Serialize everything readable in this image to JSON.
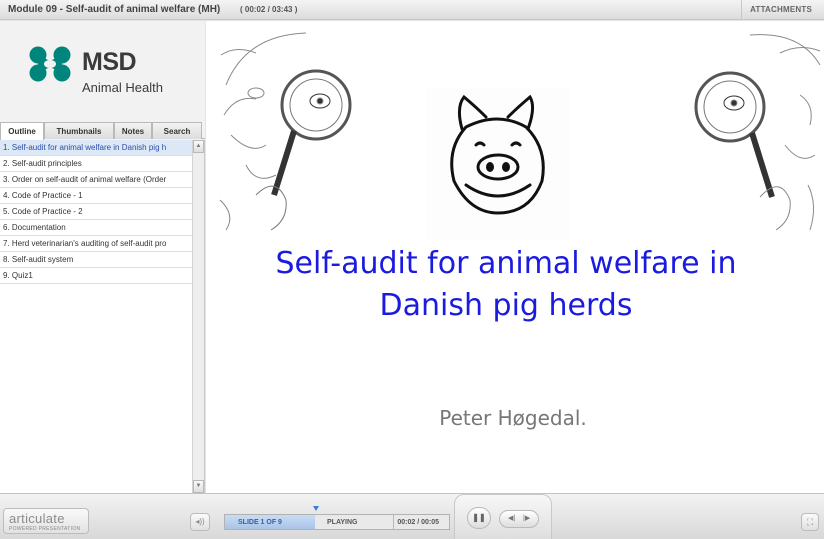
{
  "player": {
    "title": "Module 09 - Self-audit of animal welfare (MH)",
    "time": "( 00:02 / 03:43 )",
    "attachments_label": "ATTACHMENTS"
  },
  "logo": {
    "brand": "MSD",
    "sub": "Animal Health",
    "color": "#00857c"
  },
  "tabs": [
    {
      "label": "Outline",
      "active": true
    },
    {
      "label": "Thumbnails",
      "active": false
    },
    {
      "label": "Notes",
      "active": false
    },
    {
      "label": "Search",
      "active": false
    }
  ],
  "outline": {
    "items": [
      {
        "label": "1. Self-audit for animal welfare in Danish pig h",
        "active": true
      },
      {
        "label": "2. Self-audit principles",
        "active": false
      },
      {
        "label": "3. Order on self-audit of animal welfare (Order",
        "active": false
      },
      {
        "label": "4. Code of Practice - 1",
        "active": false
      },
      {
        "label": "5. Code of Practice - 2",
        "active": false
      },
      {
        "label": "6. Documentation",
        "active": false
      },
      {
        "label": "7. Herd veterinarian's auditing of self-audit pro",
        "active": false
      },
      {
        "label": "8. Self-audit system",
        "active": false
      },
      {
        "label": "9. Quiz1",
        "active": false
      }
    ]
  },
  "slide": {
    "title_line1": "Self-audit for animal welfare in",
    "title_line2": "Danish pig herds",
    "presenter": "Peter Høgedal.",
    "title_color": "#1a1ae0"
  },
  "playback": {
    "slide_label": "SLIDE 1 OF 9",
    "status": "PLAYING",
    "elapsed": "00:02 / 00:05",
    "progress_fraction": 0.4
  },
  "branding": {
    "name": "articulate",
    "tag": "POWERED PRESENTATION"
  },
  "icons": {
    "volume": "volume-icon",
    "pause": "pause-icon",
    "prev": "previous-icon",
    "next": "next-icon",
    "fullscreen": "fullscreen-icon"
  }
}
